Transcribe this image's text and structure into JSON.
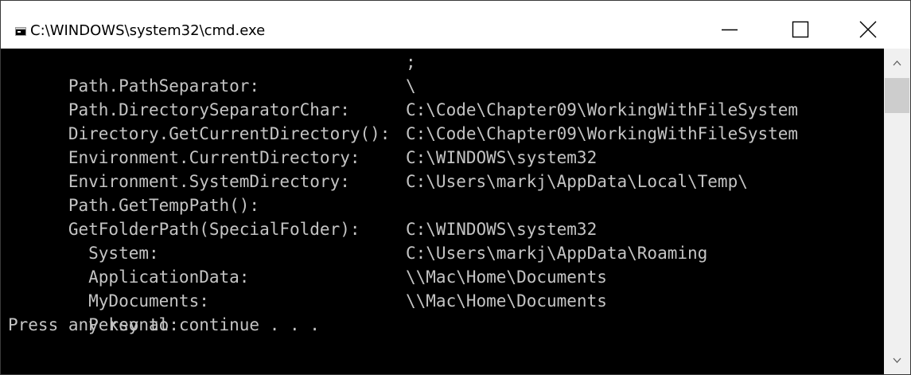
{
  "window": {
    "title": "C:\\WINDOWS\\system32\\cmd.exe",
    "icon": "cmd-icon",
    "controls": {
      "minimize_icon": "minimize-icon",
      "maximize_icon": "maximize-icon",
      "close_icon": "close-icon"
    }
  },
  "console": {
    "background": "#000000",
    "foreground": "#c4c4c4",
    "lines": [
      {
        "label": "Path.PathSeparator:",
        "value": ";"
      },
      {
        "label": "Path.DirectorySeparatorChar:",
        "value": "\\"
      },
      {
        "label": "Directory.GetCurrentDirectory():",
        "value": "C:\\Code\\Chapter09\\WorkingWithFileSystem"
      },
      {
        "label": "Environment.CurrentDirectory:",
        "value": "C:\\Code\\Chapter09\\WorkingWithFileSystem"
      },
      {
        "label": "Environment.SystemDirectory:",
        "value": "C:\\WINDOWS\\system32"
      },
      {
        "label": "Path.GetTempPath():",
        "value": "C:\\Users\\markj\\AppData\\Local\\Temp\\"
      },
      {
        "label": "GetFolderPath(SpecialFolder):",
        "value": ""
      },
      {
        "label": "  System:",
        "value": "C:\\WINDOWS\\system32"
      },
      {
        "label": "  ApplicationData:",
        "value": "C:\\Users\\markj\\AppData\\Roaming"
      },
      {
        "label": "  MyDocuments:",
        "value": "\\\\Mac\\Home\\Documents"
      },
      {
        "label": "  Personal:",
        "value": "\\\\Mac\\Home\\Documents"
      }
    ],
    "prompt": "Press any key to continue . . ."
  },
  "scrollbar": {
    "up_icon": "chevron-up-icon",
    "down_icon": "chevron-down-icon"
  }
}
